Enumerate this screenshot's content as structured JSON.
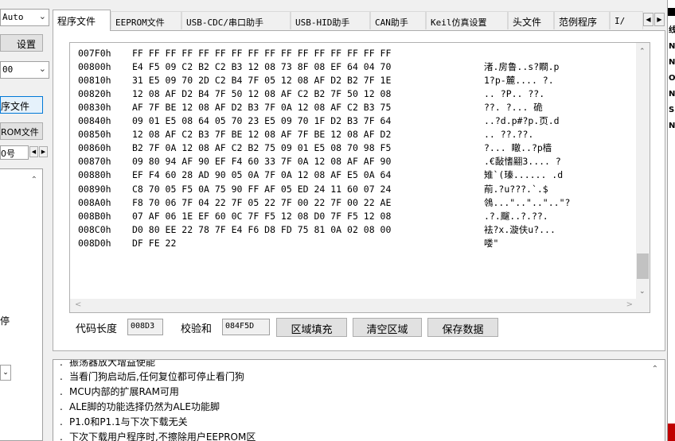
{
  "left": {
    "combo_auto": "Auto",
    "settings_button": "设置",
    "combo_2_value": "00",
    "program_file_button": "序文件",
    "eeprom_file_button": "ROM文件",
    "combo_3_label": "0号",
    "side_text": "停"
  },
  "tabs": [
    {
      "label": "程序文件",
      "active": true
    },
    {
      "label": "EEPROM文件"
    },
    {
      "label": "USB-CDC/串口助手"
    },
    {
      "label": "USB-HID助手"
    },
    {
      "label": "CAN助手"
    },
    {
      "label": "Keil仿真设置"
    },
    {
      "label": "头文件"
    },
    {
      "label": "范例程序"
    },
    {
      "label": "I/"
    }
  ],
  "hex": {
    "rows": [
      {
        "addr": "007F0h",
        "bytes": "FF FF FF FF FF FF FF FF FF FF FF FF FF FF FF FF",
        "ascii": ""
      },
      {
        "addr": "00800h",
        "bytes": "E4 F5 09 C2 B2 C2 B3 12 08 73 8F 08 EF 64 04 70",
        "ascii": "渚.房鲁..s?瞷.p"
      },
      {
        "addr": "00810h",
        "bytes": "31 E5 09 70 2D C2 B4 7F 05 12 08 AF D2 B2 7F 1E",
        "ascii": "1?p-麓.... ?."
      },
      {
        "addr": "00820h",
        "bytes": "12 08 AF D2 B4 7F 50 12 08 AF C2 B2 7F 50 12 08",
        "ascii": ".. ?P.. ??."
      },
      {
        "addr": "00830h",
        "bytes": "AF 7F BE 12 08 AF D2 B3 7F 0A 12 08 AF C2 B3 75",
        "ascii": "??. ?... 硊"
      },
      {
        "addr": "00840h",
        "bytes": "09 01 E5 08 64 05 70 23 E5 09 70 1F D2 B3 7F 64",
        "ascii": "..?d.p#?p.页.d"
      },
      {
        "addr": "00850h",
        "bytes": "12 08 AF C2 B3 7F BE 12 08 AF 7F BE 12 08 AF D2",
        "ascii": ".. ??.??."
      },
      {
        "addr": "00860h",
        "bytes": "B2 7F 0A 12 08 AF C2 B2 75 09 01 E5 08 70 98 F5",
        "ascii": "?... 瞮..?p樯"
      },
      {
        "addr": "00870h",
        "bytes": "09 80 94 AF 90 EF F4 60 33 7F 0A 12 08 AF AF 90",
        "ascii": ".€敮愭翤3.... ?"
      },
      {
        "addr": "00880h",
        "bytes": "EF F4 60 28 AD 90 05 0A 7F 0A 12 08 AF E5 0A 64",
        "ascii": "雉`(瑧...... .d"
      },
      {
        "addr": "00890h",
        "bytes": "C8 70 05 F5 0A 75 90 FF AF 05 ED 24 11 60 07 24",
        "ascii": "萷.?u???.`.$"
      },
      {
        "addr": "008A0h",
        "bytes": "F8 70 06 7F 04 22 7F 05 22 7F 00 22 7F 00 22 AE",
        "ascii": "鴒...\"..\"..\"..\"?"
      },
      {
        "addr": "008B0h",
        "bytes": "07 AF 06 1E EF 60 0C 7F F5 12 08 D0 7F F5 12 08",
        "ascii": ".?.飀..?.??."
      },
      {
        "addr": "008C0h",
        "bytes": "D0 80 EE 22 78 7F E4 F6 D8 FD 75 81 0A 02 08 00",
        "ascii": "袪?x.漩伕u?..."
      },
      {
        "addr": "008D0h",
        "bytes": "DF FE 22",
        "ascii": "喽\""
      }
    ]
  },
  "bottom": {
    "code_length_label": "代码长度",
    "code_length_value": "008D3",
    "checksum_label": "校验和",
    "checksum_value": "084F5D",
    "fill_button": "区域填充",
    "clear_button": "清空区域",
    "save_button": "保存数据"
  },
  "log": {
    "lines": [
      {
        "text": "振荡器放大增益使能"
      },
      {
        "text": "当看门狗启动后,任何复位都可停止看门狗"
      },
      {
        "text": "MCU内部的扩展RAM可用",
        "mono_prefix": "MCU",
        "rest": "内部的扩展",
        "mono_mid": "RAM",
        "tail": "可用"
      },
      {
        "text": "ALE脚的功能选择仍然为ALE功能脚"
      },
      {
        "text": "P1.0和P1.1与下次下载无关"
      },
      {
        "text": "下次下载用户程序时,不擦除用户EEPROM区"
      }
    ]
  },
  "right_edge": {
    "chars": [
      "线",
      "N",
      "N",
      "O",
      "N",
      "S",
      "N"
    ]
  },
  "colors": {
    "background": "#f0f0f0",
    "active_border": "#0078d7",
    "stop_red": "#c00000"
  }
}
